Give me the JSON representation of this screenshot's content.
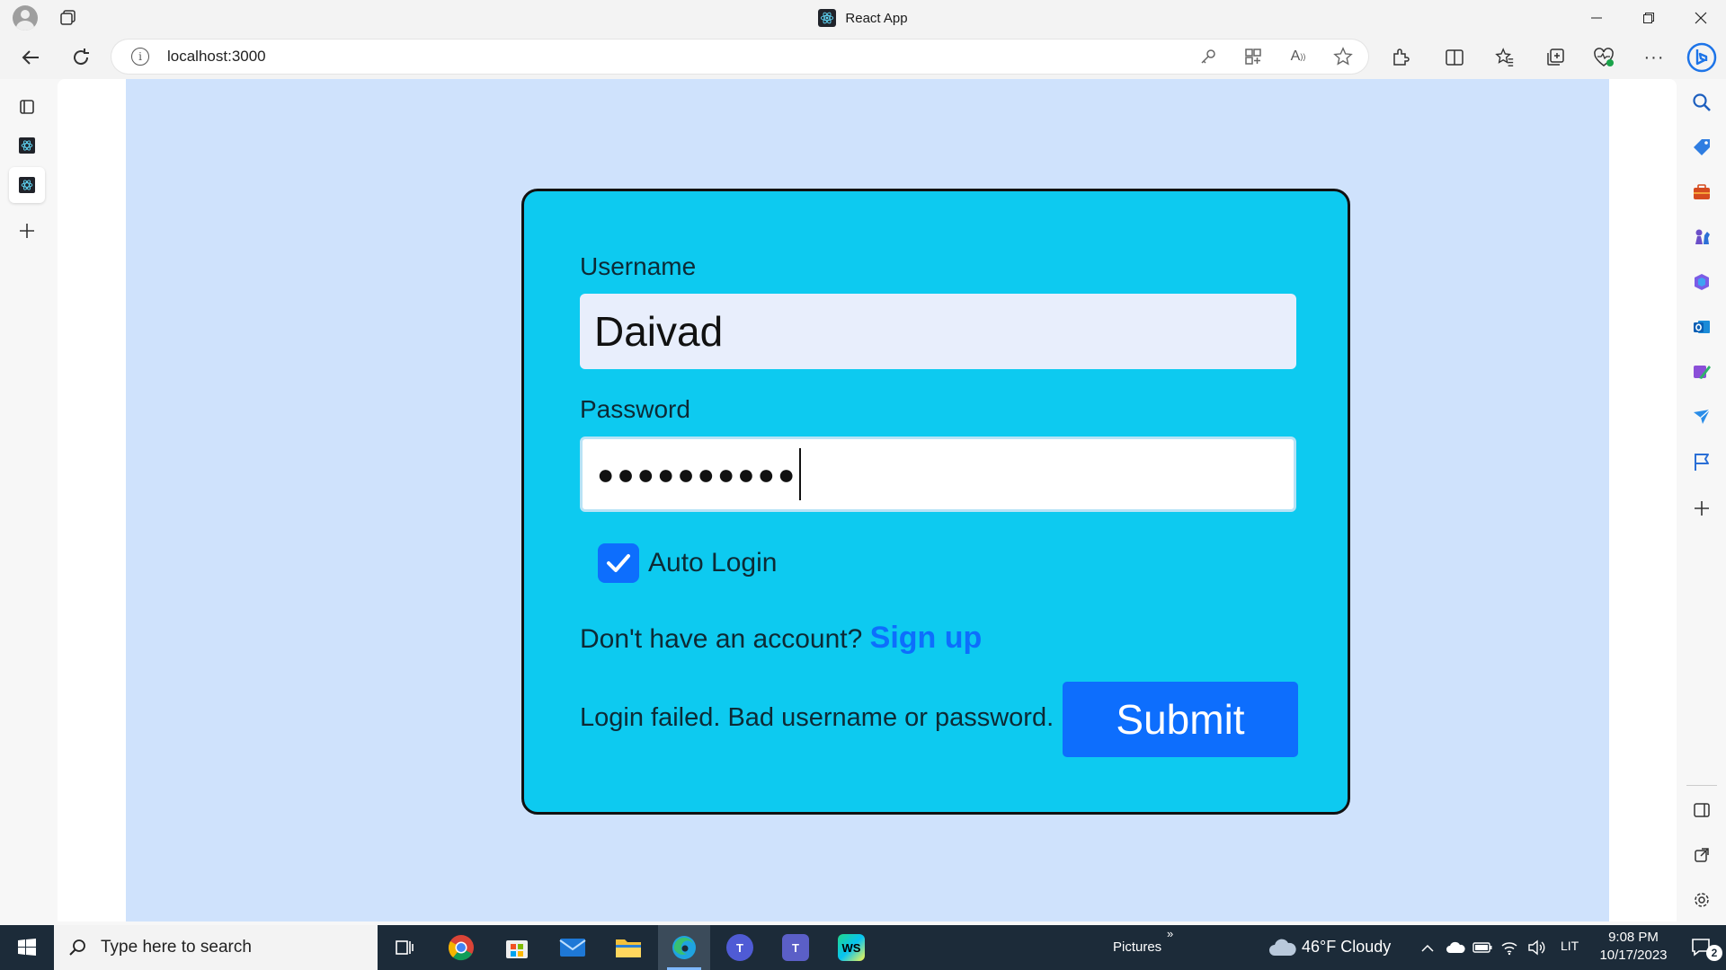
{
  "browser": {
    "tab_title": "React App",
    "url": "localhost:3000"
  },
  "login": {
    "username_label": "Username",
    "username_value": "Daivad",
    "password_label": "Password",
    "password_masked": "●●●●●●●●●●",
    "auto_login_label": "Auto Login",
    "auto_login_checked": true,
    "signup_prompt": "Don't have an account?",
    "signup_link": "Sign up",
    "error_message": "Login failed. Bad username or password.",
    "submit_label": "Submit"
  },
  "taskbar": {
    "search_placeholder": "Type here to search",
    "pictures_label": "Pictures",
    "pictures_chevron": "»",
    "weather": "46°F  Cloudy",
    "language": "LIT",
    "time": "9:08 PM",
    "date": "10/17/2023",
    "notification_count": "2"
  },
  "colors": {
    "page_background": "#cfe2fc",
    "card_background": "#0dcaf0",
    "primary": "#0d6efd",
    "taskbar": "#1c2b39"
  }
}
